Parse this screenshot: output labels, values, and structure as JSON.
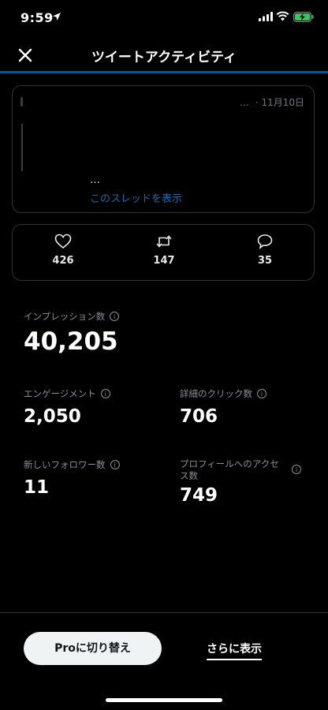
{
  "status_bar": {
    "time": "9:59"
  },
  "header": {
    "title": "ツイートアクティビティ"
  },
  "tweet": {
    "meta_dots": "…",
    "date": "· 11月10日",
    "ellipsis": "…",
    "thread_link": "このスレッドを表示"
  },
  "engagement": {
    "likes": "426",
    "retweets": "147",
    "replies": "35"
  },
  "metrics": {
    "impressions": {
      "label": "インプレッション数",
      "value": "40,205"
    },
    "engagements": {
      "label": "エンゲージメント",
      "value": "2,050"
    },
    "detail_clicks": {
      "label": "詳細のクリック数",
      "value": "706"
    },
    "new_followers": {
      "label": "新しいフォロワー数",
      "value": "11"
    },
    "profile_visits": {
      "label": "プロフィールへのアクセス数",
      "value": "749"
    }
  },
  "footer": {
    "pro_button": "Proに切り替え",
    "more_link": "さらに表示"
  },
  "icons": {
    "close": "close-icon",
    "like": "heart-icon",
    "retweet": "retweet-icon",
    "reply": "reply-icon",
    "info": "info-icon"
  },
  "colors": {
    "accent": "#1d9bf0",
    "background": "#000000",
    "battery": "#34c759"
  }
}
